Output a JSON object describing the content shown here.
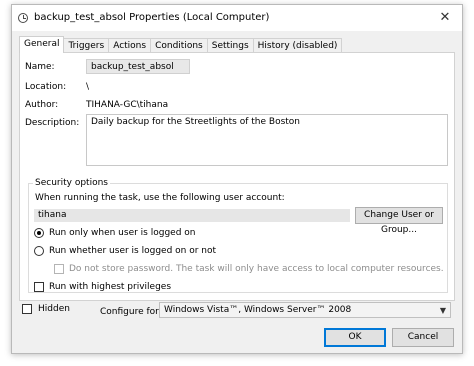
{
  "window": {
    "title": "backup_test_absol Properties (Local Computer)",
    "close_glyph": "✕"
  },
  "tabs": [
    {
      "label": "General",
      "active": true
    },
    {
      "label": "Triggers",
      "active": false
    },
    {
      "label": "Actions",
      "active": false
    },
    {
      "label": "Conditions",
      "active": false
    },
    {
      "label": "Settings",
      "active": false
    },
    {
      "label": "History (disabled)",
      "active": false
    }
  ],
  "general": {
    "name_label": "Name:",
    "name_value": "backup_test_absol",
    "location_label": "Location:",
    "location_value": "\\",
    "author_label": "Author:",
    "author_value": "TIHANA-GC\\tihana",
    "description_label": "Description:",
    "description_value": "Daily backup for the Streetlights of the Boston"
  },
  "security": {
    "title": "Security options",
    "account_prompt": "When running the task, use the following user account:",
    "user_account": "tihana",
    "change_user_button": "Change User or Group...",
    "radio_logged_on": {
      "label": "Run only when user is logged on",
      "checked": true
    },
    "radio_whether": {
      "label": "Run whether user is logged on or not",
      "checked": false
    },
    "no_store_password": {
      "label": "Do not store password.  The task will only have access to local computer resources.",
      "checked": false,
      "disabled": true
    },
    "highest_privileges": {
      "label": "Run with highest privileges",
      "checked": false
    }
  },
  "footer": {
    "hidden_label": "Hidden",
    "configure_label": "Configure for:",
    "configure_value": "Windows Vista™, Windows Server™ 2008",
    "ok_button": "OK",
    "cancel_button": "Cancel"
  },
  "icons": {
    "app": "clock-icon",
    "dropdown": "chevron-down-icon"
  },
  "colors": {
    "accent": "#0078d7",
    "disabled_text": "#8d8d8d"
  }
}
